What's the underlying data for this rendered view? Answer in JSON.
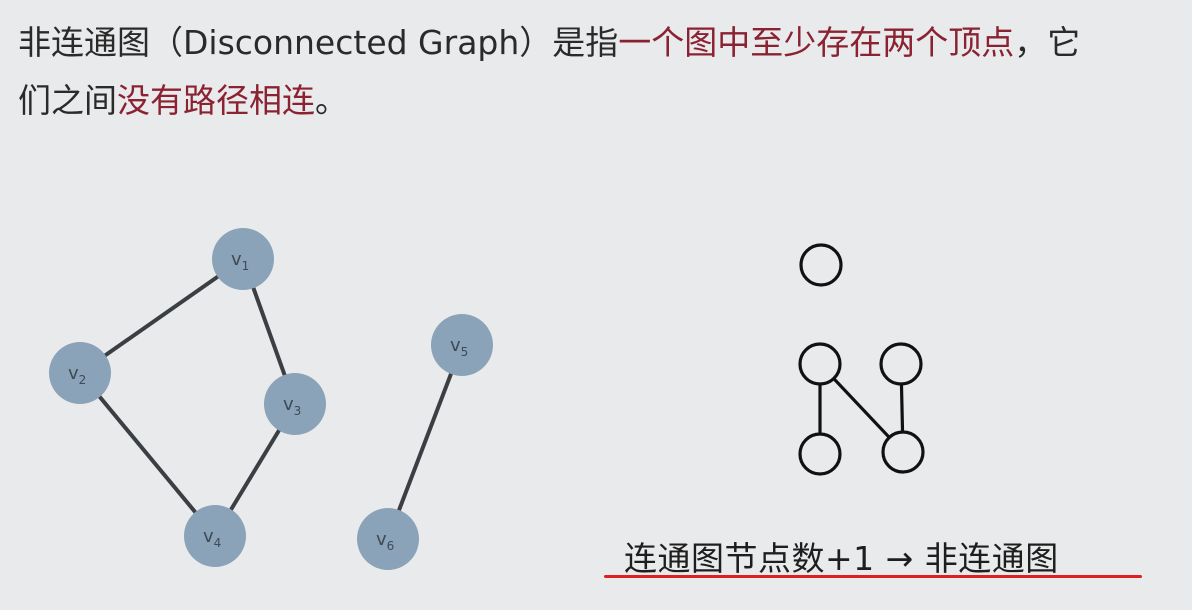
{
  "paragraph": {
    "line1_part1": "非连通图（Disconnected Graph）是指",
    "line1_highlight": "一个图中至少存在两个顶点",
    "line1_part2": "，它",
    "line2_part1": "们之间",
    "line2_highlight": "没有路径相连",
    "line2_part2": "。"
  },
  "colors": {
    "text": "#2a2a2a",
    "highlight": "#8b2232",
    "node_fill": "#8aa3b8",
    "edge": "#3b3f44",
    "underline": "#e02020"
  },
  "graph_left": {
    "nodes": [
      {
        "id": "v1",
        "letter": "v",
        "sub": "1"
      },
      {
        "id": "v2",
        "letter": "v",
        "sub": "2"
      },
      {
        "id": "v3",
        "letter": "v",
        "sub": "3"
      },
      {
        "id": "v4",
        "letter": "v",
        "sub": "4"
      },
      {
        "id": "v5",
        "letter": "v",
        "sub": "5"
      },
      {
        "id": "v6",
        "letter": "v",
        "sub": "6"
      }
    ],
    "edges": [
      [
        "v1",
        "v2"
      ],
      [
        "v1",
        "v3"
      ],
      [
        "v2",
        "v4"
      ],
      [
        "v3",
        "v4"
      ],
      [
        "v5",
        "v6"
      ]
    ]
  },
  "graph_right": {
    "nodes": [
      "a",
      "b",
      "c",
      "d",
      "e"
    ],
    "edges": [
      [
        "b",
        "d"
      ],
      [
        "b",
        "e"
      ],
      [
        "c",
        "e"
      ]
    ]
  },
  "caption": {
    "text": "连通图节点数+1  →  非连通图"
  }
}
